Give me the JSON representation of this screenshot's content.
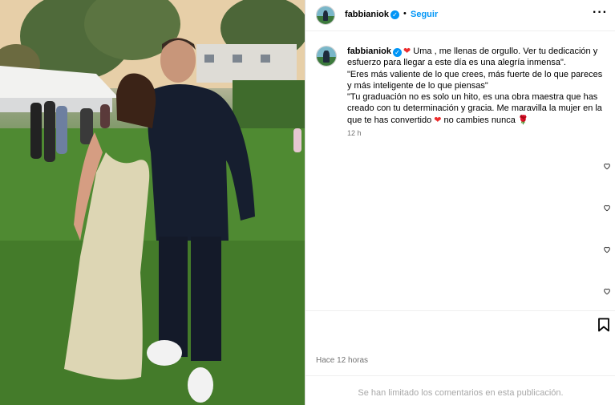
{
  "post": {
    "author": {
      "username": "fabbianiok",
      "verified": true
    },
    "header": {
      "follow_label": "Seguir",
      "separator": "•",
      "more_label": "···"
    },
    "caption": {
      "username": "fabbianiok",
      "lines": [
        "Uma , me llenas de orgullo. Ver tu dedicación y",
        "esfuerzo para llegar a este día es una alegría inmensa\".",
        "\"Eres más valiente de lo que crees, más fuerte de lo que pareces",
        "y más inteligente de lo que piensas\"",
        "\"Tu graduación no es solo un hito, es una obra maestra que has",
        "creado con tu determinación y gracia. Me maravilla la mujer en la",
        "que te has convertido",
        "no cambies nunca"
      ],
      "emoji_heart": "❤",
      "emoji_rose": "🌹",
      "time_ago": "12 h"
    },
    "footer": {
      "time_full": "Hace 12 horas",
      "comments_notice": "Se han limitado los comentarios en esta publicación."
    },
    "icons": {
      "heart": "heart-outline-icon",
      "bookmark": "bookmark-icon",
      "verified": "verified-badge-icon",
      "more": "more-options-icon"
    },
    "colors": {
      "link_blue": "#0095f6",
      "secondary_text": "#737373",
      "muted_text": "#a8a8a8",
      "heart_red": "#ed2b2b"
    }
  }
}
